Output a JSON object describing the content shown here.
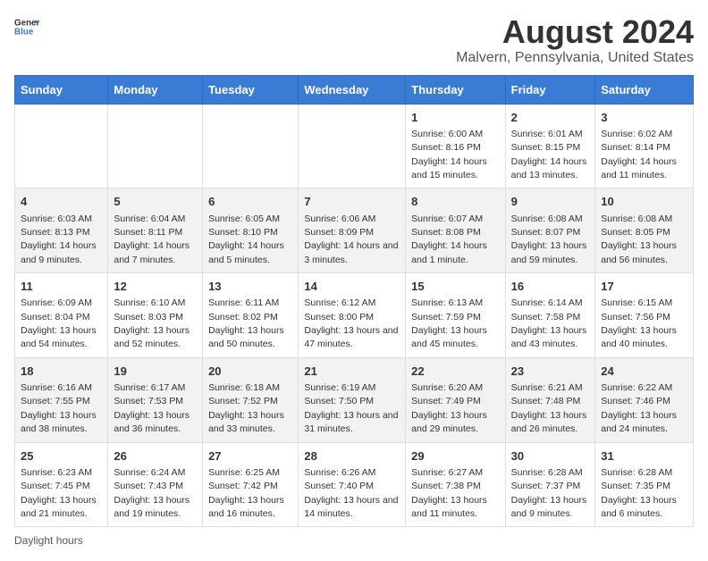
{
  "logo": {
    "text_general": "General",
    "text_blue": "Blue"
  },
  "header": {
    "title": "August 2024",
    "subtitle": "Malvern, Pennsylvania, United States"
  },
  "days_of_week": [
    "Sunday",
    "Monday",
    "Tuesday",
    "Wednesday",
    "Thursday",
    "Friday",
    "Saturday"
  ],
  "footer": {
    "note": "Daylight hours"
  },
  "weeks": [
    [
      {
        "day": "",
        "sunrise": "",
        "sunset": "",
        "daylight": ""
      },
      {
        "day": "",
        "sunrise": "",
        "sunset": "",
        "daylight": ""
      },
      {
        "day": "",
        "sunrise": "",
        "sunset": "",
        "daylight": ""
      },
      {
        "day": "",
        "sunrise": "",
        "sunset": "",
        "daylight": ""
      },
      {
        "day": "1",
        "sunrise": "Sunrise: 6:00 AM",
        "sunset": "Sunset: 8:16 PM",
        "daylight": "Daylight: 14 hours and 15 minutes."
      },
      {
        "day": "2",
        "sunrise": "Sunrise: 6:01 AM",
        "sunset": "Sunset: 8:15 PM",
        "daylight": "Daylight: 14 hours and 13 minutes."
      },
      {
        "day": "3",
        "sunrise": "Sunrise: 6:02 AM",
        "sunset": "Sunset: 8:14 PM",
        "daylight": "Daylight: 14 hours and 11 minutes."
      }
    ],
    [
      {
        "day": "4",
        "sunrise": "Sunrise: 6:03 AM",
        "sunset": "Sunset: 8:13 PM",
        "daylight": "Daylight: 14 hours and 9 minutes."
      },
      {
        "day": "5",
        "sunrise": "Sunrise: 6:04 AM",
        "sunset": "Sunset: 8:11 PM",
        "daylight": "Daylight: 14 hours and 7 minutes."
      },
      {
        "day": "6",
        "sunrise": "Sunrise: 6:05 AM",
        "sunset": "Sunset: 8:10 PM",
        "daylight": "Daylight: 14 hours and 5 minutes."
      },
      {
        "day": "7",
        "sunrise": "Sunrise: 6:06 AM",
        "sunset": "Sunset: 8:09 PM",
        "daylight": "Daylight: 14 hours and 3 minutes."
      },
      {
        "day": "8",
        "sunrise": "Sunrise: 6:07 AM",
        "sunset": "Sunset: 8:08 PM",
        "daylight": "Daylight: 14 hours and 1 minute."
      },
      {
        "day": "9",
        "sunrise": "Sunrise: 6:08 AM",
        "sunset": "Sunset: 8:07 PM",
        "daylight": "Daylight: 13 hours and 59 minutes."
      },
      {
        "day": "10",
        "sunrise": "Sunrise: 6:08 AM",
        "sunset": "Sunset: 8:05 PM",
        "daylight": "Daylight: 13 hours and 56 minutes."
      }
    ],
    [
      {
        "day": "11",
        "sunrise": "Sunrise: 6:09 AM",
        "sunset": "Sunset: 8:04 PM",
        "daylight": "Daylight: 13 hours and 54 minutes."
      },
      {
        "day": "12",
        "sunrise": "Sunrise: 6:10 AM",
        "sunset": "Sunset: 8:03 PM",
        "daylight": "Daylight: 13 hours and 52 minutes."
      },
      {
        "day": "13",
        "sunrise": "Sunrise: 6:11 AM",
        "sunset": "Sunset: 8:02 PM",
        "daylight": "Daylight: 13 hours and 50 minutes."
      },
      {
        "day": "14",
        "sunrise": "Sunrise: 6:12 AM",
        "sunset": "Sunset: 8:00 PM",
        "daylight": "Daylight: 13 hours and 47 minutes."
      },
      {
        "day": "15",
        "sunrise": "Sunrise: 6:13 AM",
        "sunset": "Sunset: 7:59 PM",
        "daylight": "Daylight: 13 hours and 45 minutes."
      },
      {
        "day": "16",
        "sunrise": "Sunrise: 6:14 AM",
        "sunset": "Sunset: 7:58 PM",
        "daylight": "Daylight: 13 hours and 43 minutes."
      },
      {
        "day": "17",
        "sunrise": "Sunrise: 6:15 AM",
        "sunset": "Sunset: 7:56 PM",
        "daylight": "Daylight: 13 hours and 40 minutes."
      }
    ],
    [
      {
        "day": "18",
        "sunrise": "Sunrise: 6:16 AM",
        "sunset": "Sunset: 7:55 PM",
        "daylight": "Daylight: 13 hours and 38 minutes."
      },
      {
        "day": "19",
        "sunrise": "Sunrise: 6:17 AM",
        "sunset": "Sunset: 7:53 PM",
        "daylight": "Daylight: 13 hours and 36 minutes."
      },
      {
        "day": "20",
        "sunrise": "Sunrise: 6:18 AM",
        "sunset": "Sunset: 7:52 PM",
        "daylight": "Daylight: 13 hours and 33 minutes."
      },
      {
        "day": "21",
        "sunrise": "Sunrise: 6:19 AM",
        "sunset": "Sunset: 7:50 PM",
        "daylight": "Daylight: 13 hours and 31 minutes."
      },
      {
        "day": "22",
        "sunrise": "Sunrise: 6:20 AM",
        "sunset": "Sunset: 7:49 PM",
        "daylight": "Daylight: 13 hours and 29 minutes."
      },
      {
        "day": "23",
        "sunrise": "Sunrise: 6:21 AM",
        "sunset": "Sunset: 7:48 PM",
        "daylight": "Daylight: 13 hours and 26 minutes."
      },
      {
        "day": "24",
        "sunrise": "Sunrise: 6:22 AM",
        "sunset": "Sunset: 7:46 PM",
        "daylight": "Daylight: 13 hours and 24 minutes."
      }
    ],
    [
      {
        "day": "25",
        "sunrise": "Sunrise: 6:23 AM",
        "sunset": "Sunset: 7:45 PM",
        "daylight": "Daylight: 13 hours and 21 minutes."
      },
      {
        "day": "26",
        "sunrise": "Sunrise: 6:24 AM",
        "sunset": "Sunset: 7:43 PM",
        "daylight": "Daylight: 13 hours and 19 minutes."
      },
      {
        "day": "27",
        "sunrise": "Sunrise: 6:25 AM",
        "sunset": "Sunset: 7:42 PM",
        "daylight": "Daylight: 13 hours and 16 minutes."
      },
      {
        "day": "28",
        "sunrise": "Sunrise: 6:26 AM",
        "sunset": "Sunset: 7:40 PM",
        "daylight": "Daylight: 13 hours and 14 minutes."
      },
      {
        "day": "29",
        "sunrise": "Sunrise: 6:27 AM",
        "sunset": "Sunset: 7:38 PM",
        "daylight": "Daylight: 13 hours and 11 minutes."
      },
      {
        "day": "30",
        "sunrise": "Sunrise: 6:28 AM",
        "sunset": "Sunset: 7:37 PM",
        "daylight": "Daylight: 13 hours and 9 minutes."
      },
      {
        "day": "31",
        "sunrise": "Sunrise: 6:28 AM",
        "sunset": "Sunset: 7:35 PM",
        "daylight": "Daylight: 13 hours and 6 minutes."
      }
    ]
  ]
}
